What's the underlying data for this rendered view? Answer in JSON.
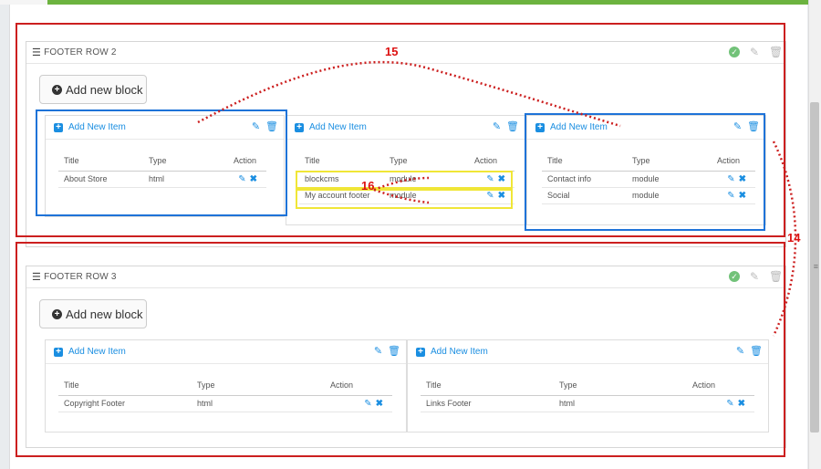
{
  "rows": [
    {
      "title": "FOOTER ROW 2",
      "add_block_label": "Add new block",
      "blocks": [
        {
          "add_item_label": "Add New Item",
          "headers": [
            "Title",
            "Type",
            "Action"
          ],
          "items": [
            {
              "title": "About Store",
              "type": "html"
            }
          ]
        },
        {
          "add_item_label": "Add New Item",
          "headers": [
            "Title",
            "Type",
            "Action"
          ],
          "items": [
            {
              "title": "blockcms",
              "type": "module"
            },
            {
              "title": "My account footer",
              "type": "module"
            }
          ]
        },
        {
          "add_item_label": "Add New Item",
          "headers": [
            "Title",
            "Type",
            "Action"
          ],
          "items": [
            {
              "title": "Contact info",
              "type": "module"
            },
            {
              "title": "Social",
              "type": "module"
            }
          ]
        }
      ]
    },
    {
      "title": "FOOTER ROW 3",
      "add_block_label": "Add new block",
      "blocks": [
        {
          "add_item_label": "Add New Item",
          "headers": [
            "Title",
            "Type",
            "Action"
          ],
          "items": [
            {
              "title": "Copyright Footer",
              "type": "html"
            }
          ]
        },
        {
          "add_item_label": "Add New Item",
          "headers": [
            "Title",
            "Type",
            "Action"
          ],
          "items": [
            {
              "title": "Links Footer",
              "type": "html"
            }
          ]
        }
      ]
    }
  ],
  "annotations": {
    "a15": "15",
    "a16": "16",
    "a14": "14"
  },
  "colors": {
    "accent": "#1a8ee1",
    "annotation_red": "#cc1f1f",
    "annotation_blue": "#1e73d8",
    "annotation_yellow": "#f0e637",
    "topbar_green": "#6cb33f"
  }
}
